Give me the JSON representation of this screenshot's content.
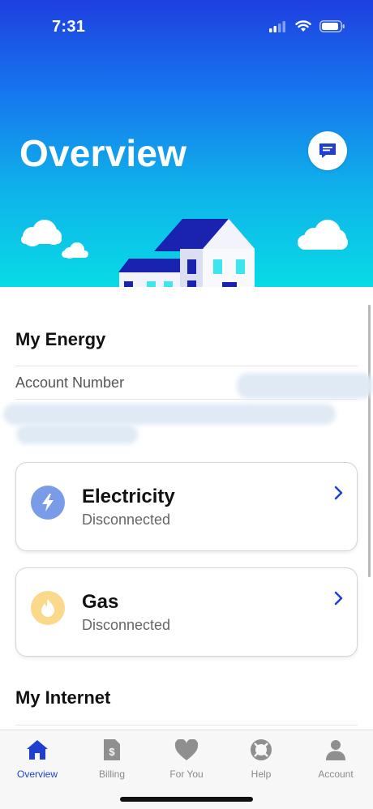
{
  "status_bar": {
    "time": "7:31",
    "signal_icon": "cellular-signal-icon",
    "wifi_icon": "wifi-icon",
    "battery_icon": "battery-icon"
  },
  "header": {
    "title": "Overview",
    "chat_icon": "chat-bubble-icon"
  },
  "energy": {
    "title": "My Energy",
    "account_label": "Account Number",
    "services": [
      {
        "name": "Electricity",
        "status": "Disconnected",
        "icon": "lightning-bolt-icon",
        "icon_bg": "#7a9ce8"
      },
      {
        "name": "Gas",
        "status": "Disconnected",
        "icon": "flame-icon",
        "icon_bg": "#fbd98a"
      }
    ]
  },
  "internet": {
    "title": "My Internet"
  },
  "tabbar": {
    "tabs": [
      {
        "label": "Overview",
        "icon": "home-icon",
        "active": true
      },
      {
        "label": "Billing",
        "icon": "bill-icon",
        "active": false
      },
      {
        "label": "For You",
        "icon": "heart-icon",
        "active": false
      },
      {
        "label": "Help",
        "icon": "lifebuoy-icon",
        "active": false
      },
      {
        "label": "Account",
        "icon": "person-icon",
        "active": false
      }
    ]
  },
  "colors": {
    "brand_blue": "#1f3fd0",
    "accent_cyan": "#08dbe6",
    "chevron": "#1f3fd0"
  }
}
